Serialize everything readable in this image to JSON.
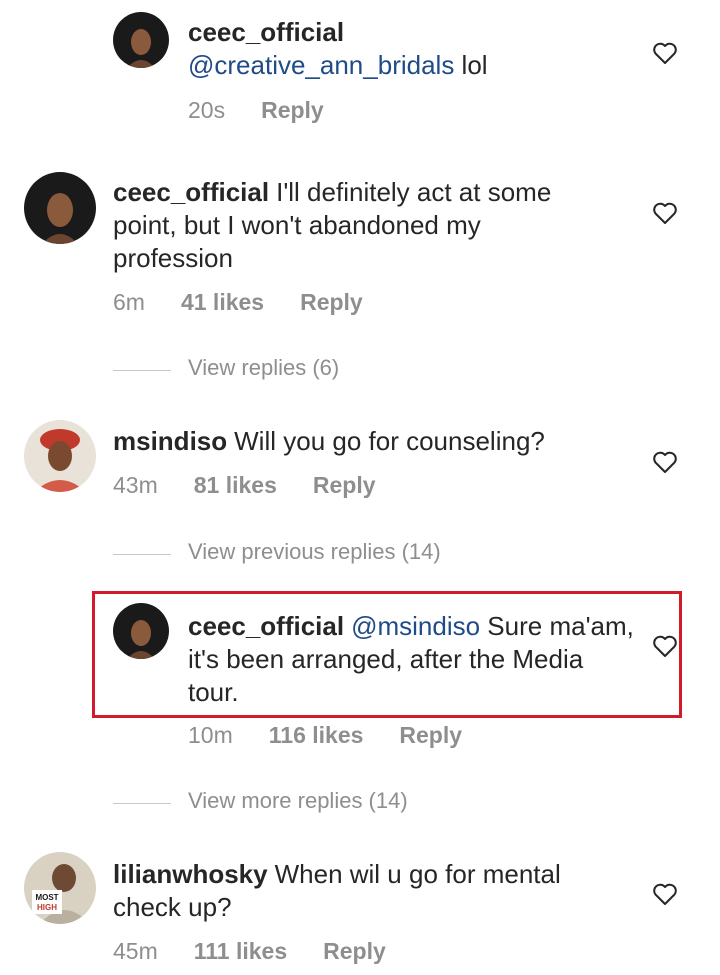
{
  "comments": [
    {
      "username": "ceec_official",
      "mention": "@creative_ann_bridals",
      "text": " lol",
      "time": "20s",
      "likes": "",
      "reply_label": "Reply"
    },
    {
      "username": "ceec_official",
      "mention": "",
      "text": "I'll definitely act at some point, but I won't abandoned my profession",
      "time": "6m",
      "likes": "41 likes",
      "reply_label": "Reply"
    },
    {
      "username": "msindiso",
      "mention": "",
      "text": "Will you go for counseling?",
      "time": "43m",
      "likes": "81 likes",
      "reply_label": "Reply"
    },
    {
      "username": "ceec_official",
      "mention": "@msindiso",
      "text": " Sure ma'am, it's been arranged, after the Media tour.",
      "time": "10m",
      "likes": "116 likes",
      "reply_label": "Reply"
    },
    {
      "username": "lilianwhosky",
      "mention": "",
      "text": "When wil u go for mental check up?",
      "time": "45m",
      "likes": "111 likes",
      "reply_label": "Reply"
    }
  ],
  "view_links": {
    "view_replies": "View replies (6)",
    "view_previous": "View previous replies (14)",
    "view_more": "View more replies (14)"
  },
  "avatar_badge": {
    "line1": "MOST",
    "line2": "HIGH"
  },
  "colors": {
    "text": "#262626",
    "secondary": "#8e8e8e",
    "mention": "#1f4b87",
    "highlight_border": "#d11a2a"
  }
}
